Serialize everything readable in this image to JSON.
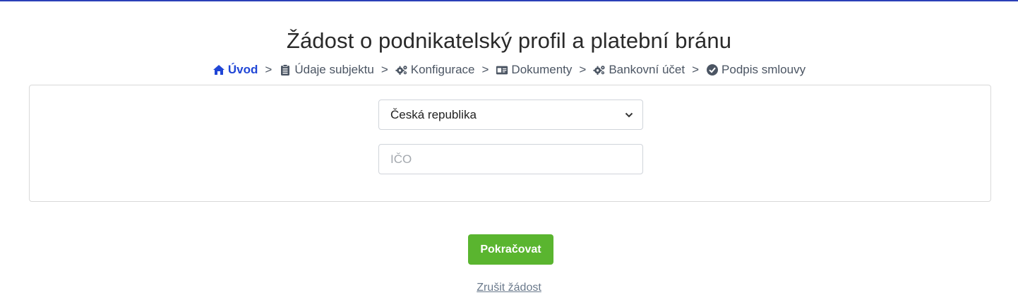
{
  "header": {
    "title": "Žádost o podnikatelský profil a platební bránu"
  },
  "steps": [
    {
      "label": "Úvod",
      "icon": "home-icon",
      "active": true
    },
    {
      "label": "Údaje subjektu",
      "icon": "clipboard-icon",
      "active": false
    },
    {
      "label": "Konfigurace",
      "icon": "gears-icon",
      "active": false
    },
    {
      "label": "Dokumenty",
      "icon": "id-card-icon",
      "active": false
    },
    {
      "label": "Bankovní účet",
      "icon": "gears-icon",
      "active": false
    },
    {
      "label": "Podpis smlouvy",
      "icon": "check-circle-icon",
      "active": false
    }
  ],
  "step_separator": ">",
  "form": {
    "country_value": "Česká republika",
    "ico_placeholder": "IČO",
    "ico_value": ""
  },
  "actions": {
    "continue_label": "Pokračovat",
    "cancel_label": "Zrušit žádost"
  },
  "colors": {
    "accent_blue": "#2046d6",
    "button_green": "#5ab52f",
    "top_line": "#2b3fb8"
  }
}
